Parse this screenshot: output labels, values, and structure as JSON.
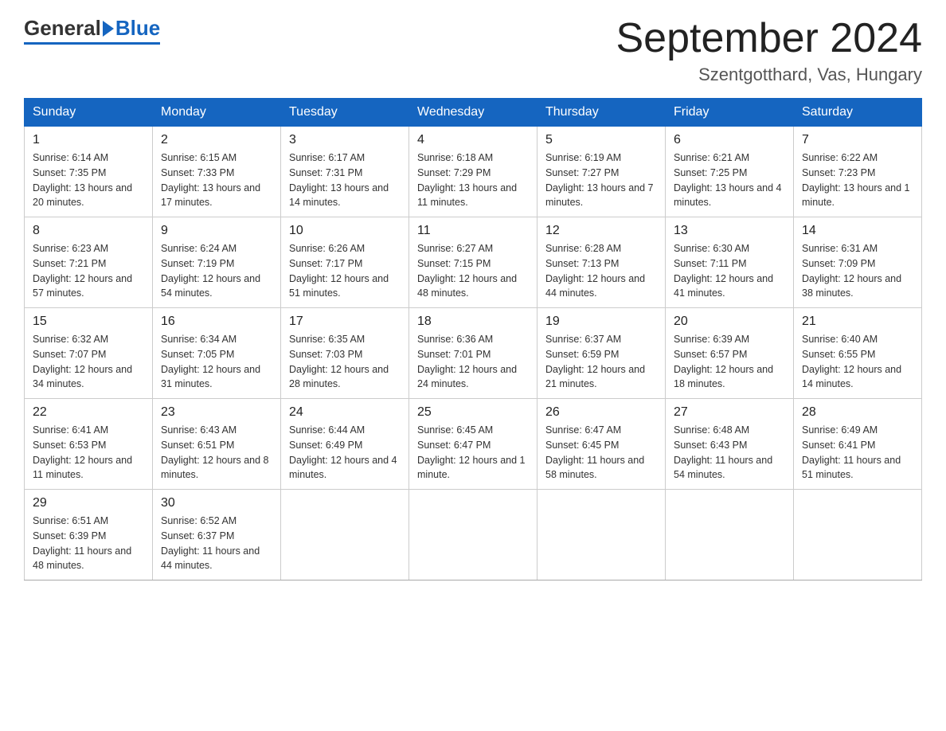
{
  "logo": {
    "general": "General",
    "blue": "Blue"
  },
  "title": {
    "month_year": "September 2024",
    "location": "Szentgotthard, Vas, Hungary"
  },
  "headers": [
    "Sunday",
    "Monday",
    "Tuesday",
    "Wednesday",
    "Thursday",
    "Friday",
    "Saturday"
  ],
  "weeks": [
    [
      {
        "day": "1",
        "sunrise": "6:14 AM",
        "sunset": "7:35 PM",
        "daylight": "13 hours and 20 minutes."
      },
      {
        "day": "2",
        "sunrise": "6:15 AM",
        "sunset": "7:33 PM",
        "daylight": "13 hours and 17 minutes."
      },
      {
        "day": "3",
        "sunrise": "6:17 AM",
        "sunset": "7:31 PM",
        "daylight": "13 hours and 14 minutes."
      },
      {
        "day": "4",
        "sunrise": "6:18 AM",
        "sunset": "7:29 PM",
        "daylight": "13 hours and 11 minutes."
      },
      {
        "day": "5",
        "sunrise": "6:19 AM",
        "sunset": "7:27 PM",
        "daylight": "13 hours and 7 minutes."
      },
      {
        "day": "6",
        "sunrise": "6:21 AM",
        "sunset": "7:25 PM",
        "daylight": "13 hours and 4 minutes."
      },
      {
        "day": "7",
        "sunrise": "6:22 AM",
        "sunset": "7:23 PM",
        "daylight": "13 hours and 1 minute."
      }
    ],
    [
      {
        "day": "8",
        "sunrise": "6:23 AM",
        "sunset": "7:21 PM",
        "daylight": "12 hours and 57 minutes."
      },
      {
        "day": "9",
        "sunrise": "6:24 AM",
        "sunset": "7:19 PM",
        "daylight": "12 hours and 54 minutes."
      },
      {
        "day": "10",
        "sunrise": "6:26 AM",
        "sunset": "7:17 PM",
        "daylight": "12 hours and 51 minutes."
      },
      {
        "day": "11",
        "sunrise": "6:27 AM",
        "sunset": "7:15 PM",
        "daylight": "12 hours and 48 minutes."
      },
      {
        "day": "12",
        "sunrise": "6:28 AM",
        "sunset": "7:13 PM",
        "daylight": "12 hours and 44 minutes."
      },
      {
        "day": "13",
        "sunrise": "6:30 AM",
        "sunset": "7:11 PM",
        "daylight": "12 hours and 41 minutes."
      },
      {
        "day": "14",
        "sunrise": "6:31 AM",
        "sunset": "7:09 PM",
        "daylight": "12 hours and 38 minutes."
      }
    ],
    [
      {
        "day": "15",
        "sunrise": "6:32 AM",
        "sunset": "7:07 PM",
        "daylight": "12 hours and 34 minutes."
      },
      {
        "day": "16",
        "sunrise": "6:34 AM",
        "sunset": "7:05 PM",
        "daylight": "12 hours and 31 minutes."
      },
      {
        "day": "17",
        "sunrise": "6:35 AM",
        "sunset": "7:03 PM",
        "daylight": "12 hours and 28 minutes."
      },
      {
        "day": "18",
        "sunrise": "6:36 AM",
        "sunset": "7:01 PM",
        "daylight": "12 hours and 24 minutes."
      },
      {
        "day": "19",
        "sunrise": "6:37 AM",
        "sunset": "6:59 PM",
        "daylight": "12 hours and 21 minutes."
      },
      {
        "day": "20",
        "sunrise": "6:39 AM",
        "sunset": "6:57 PM",
        "daylight": "12 hours and 18 minutes."
      },
      {
        "day": "21",
        "sunrise": "6:40 AM",
        "sunset": "6:55 PM",
        "daylight": "12 hours and 14 minutes."
      }
    ],
    [
      {
        "day": "22",
        "sunrise": "6:41 AM",
        "sunset": "6:53 PM",
        "daylight": "12 hours and 11 minutes."
      },
      {
        "day": "23",
        "sunrise": "6:43 AM",
        "sunset": "6:51 PM",
        "daylight": "12 hours and 8 minutes."
      },
      {
        "day": "24",
        "sunrise": "6:44 AM",
        "sunset": "6:49 PM",
        "daylight": "12 hours and 4 minutes."
      },
      {
        "day": "25",
        "sunrise": "6:45 AM",
        "sunset": "6:47 PM",
        "daylight": "12 hours and 1 minute."
      },
      {
        "day": "26",
        "sunrise": "6:47 AM",
        "sunset": "6:45 PM",
        "daylight": "11 hours and 58 minutes."
      },
      {
        "day": "27",
        "sunrise": "6:48 AM",
        "sunset": "6:43 PM",
        "daylight": "11 hours and 54 minutes."
      },
      {
        "day": "28",
        "sunrise": "6:49 AM",
        "sunset": "6:41 PM",
        "daylight": "11 hours and 51 minutes."
      }
    ],
    [
      {
        "day": "29",
        "sunrise": "6:51 AM",
        "sunset": "6:39 PM",
        "daylight": "11 hours and 48 minutes."
      },
      {
        "day": "30",
        "sunrise": "6:52 AM",
        "sunset": "6:37 PM",
        "daylight": "11 hours and 44 minutes."
      },
      null,
      null,
      null,
      null,
      null
    ]
  ],
  "labels": {
    "sunrise": "Sunrise:",
    "sunset": "Sunset:",
    "daylight": "Daylight:"
  }
}
